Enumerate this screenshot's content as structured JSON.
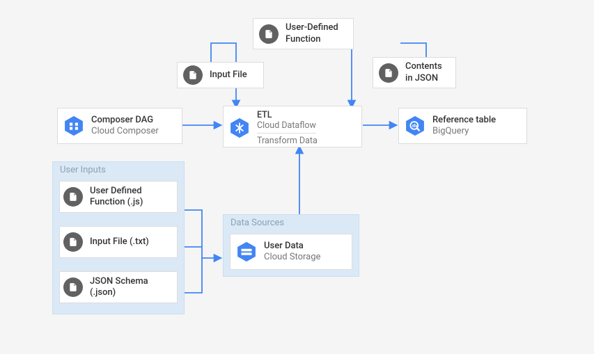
{
  "nodes": {
    "composer": {
      "title": "Composer DAG",
      "sub": "Cloud Composer"
    },
    "inputFile": {
      "title": "Input File"
    },
    "udf": {
      "title": "User-Defined",
      "sub": "Function"
    },
    "contents": {
      "title": "Contents",
      "sub": "in JSON"
    },
    "etl": {
      "title": "ETL",
      "sub": "Cloud Dataflow",
      "sub2": "Transform Data"
    },
    "reftable": {
      "title": "Reference table",
      "sub": "BigQuery"
    },
    "userInputs": {
      "panel": "User Inputs",
      "udfjs": {
        "title": "User Defined",
        "sub": "Function (.js)"
      },
      "txt": {
        "title": "Input File (.txt)"
      },
      "json": {
        "title": "JSON Schema",
        "sub": "(.json)"
      }
    },
    "dataSources": {
      "panel": "Data Sources",
      "userData": {
        "title": "User Data",
        "sub": "Cloud Storage"
      }
    }
  },
  "chart_data": {
    "type": "diagram",
    "title": "GCP ETL pipeline architecture",
    "nodes": [
      {
        "id": "composer",
        "label": "Composer DAG",
        "service": "Cloud Composer"
      },
      {
        "id": "inputFile",
        "label": "Input File",
        "group": null
      },
      {
        "id": "udf",
        "label": "User-Defined Function",
        "group": null
      },
      {
        "id": "contents",
        "label": "Contents in JSON",
        "group": null
      },
      {
        "id": "etl",
        "label": "ETL",
        "service": "Cloud Dataflow",
        "note": "Transform Data"
      },
      {
        "id": "reftable",
        "label": "Reference table",
        "service": "BigQuery"
      },
      {
        "id": "udfjs",
        "label": "User Defined Function (.js)",
        "group": "User Inputs"
      },
      {
        "id": "txt",
        "label": "Input File (.txt)",
        "group": "User Inputs"
      },
      {
        "id": "json",
        "label": "JSON Schema (.json)",
        "group": "User Inputs"
      },
      {
        "id": "userData",
        "label": "User Data",
        "service": "Cloud Storage",
        "group": "Data Sources"
      }
    ],
    "groups": [
      "User Inputs",
      "Data Sources"
    ],
    "edges": [
      {
        "from": "composer",
        "to": "etl"
      },
      {
        "from": "inputFile",
        "to": "etl"
      },
      {
        "from": "udf",
        "to": "etl"
      },
      {
        "from": "contents",
        "to": "etl"
      },
      {
        "from": "etl",
        "to": "reftable"
      },
      {
        "from": "udfjs",
        "to": "Data Sources"
      },
      {
        "from": "txt",
        "to": "Data Sources"
      },
      {
        "from": "json",
        "to": "Data Sources"
      },
      {
        "from": "userData",
        "to": "etl"
      }
    ]
  }
}
